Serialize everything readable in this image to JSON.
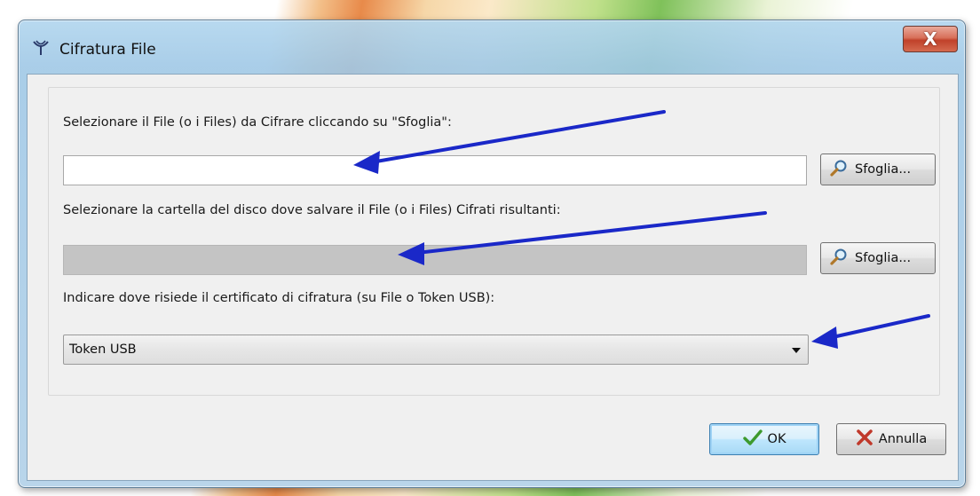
{
  "window": {
    "title": "Cifratura File",
    "close_label": "X"
  },
  "file_section": {
    "label": "Selezionare il File (o i Files) da Cifrare cliccando su \"Sfoglia\":",
    "value": "",
    "browse_label": "Sfoglia..."
  },
  "folder_section": {
    "label": "Selezionare la cartella del disco dove salvare il File (o i Files) Cifrati risultanti:",
    "value": "",
    "browse_label": "Sfoglia..."
  },
  "certificate_section": {
    "label": "Indicare dove risiede il certificato di cifratura (su File o Token USB):",
    "selected": "Token USB"
  },
  "buttons": {
    "ok_label": "OK",
    "cancel_label": "Annulla"
  },
  "colors": {
    "annotation_arrow": "#1a28c8",
    "ok_check": "#3d9a2e",
    "cancel_x": "#c0392b"
  },
  "icons": {
    "title": "encryption-antenna-icon",
    "browse": "magnifier-icon",
    "ok": "checkmark-icon",
    "cancel": "red-x-icon",
    "dropdown": "chevron-down-icon"
  }
}
